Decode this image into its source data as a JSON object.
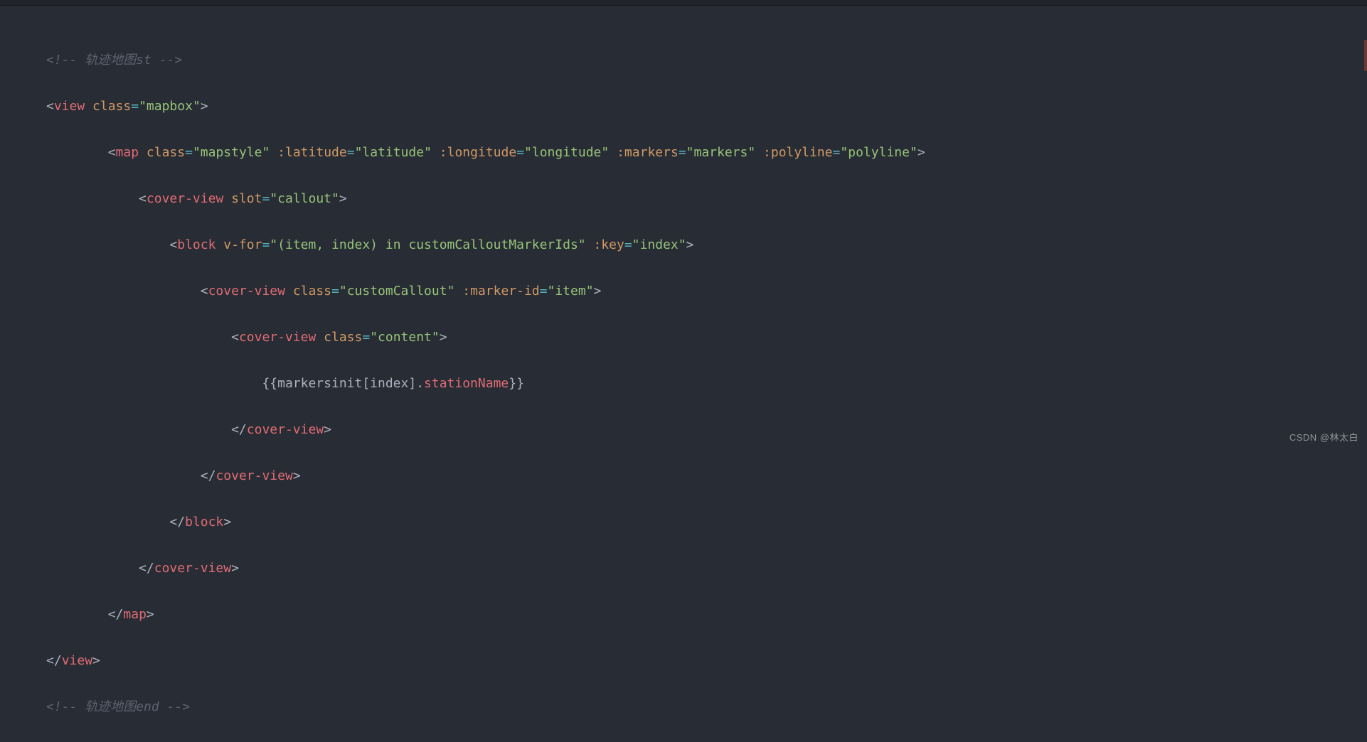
{
  "watermark": "CSDN @林太白",
  "tokens": {
    "commentStart": "<!-- 轨迹地图st -->",
    "commentEnd": "<!-- 轨迹地图end -->",
    "lt": "<",
    "ltSlash": "</",
    "gt": ">",
    "eq": "=",
    "q": "\"",
    "sp1": " ",
    "sp4": "    ",
    "indent0": "",
    "indent1": "    ",
    "indent2": "        ",
    "indent3": "            ",
    "indent4": "                ",
    "indent5": "                    ",
    "indent6": "                        ",
    "indent7": "                            ",
    "tag_view": "view",
    "tag_map": "map",
    "tag_coverview": "cover-view",
    "tag_block": "block",
    "attr_class": "class",
    "attr_slot": "slot",
    "attr_vfor": "v-for",
    "attr_key": ":key",
    "attr_lat": ":latitude",
    "attr_lon": ":longitude",
    "attr_markers": ":markers",
    "attr_polyline": ":polyline",
    "attr_markerid": ":marker-id",
    "val_mapbox": "mapbox",
    "val_mapstyle": "mapstyle",
    "val_latitude": "latitude",
    "val_longitude": "longitude",
    "val_markers": "markers",
    "val_polyline": "polyline",
    "val_callout": "callout",
    "val_vfor": "(item, index) in customCalloutMarkerIds",
    "val_index": "index",
    "val_customCallout": "customCallout",
    "val_item": "item",
    "val_content": "content",
    "interp_open": "{{",
    "interp_expr1": "markersinit[index].",
    "interp_prop": "stationName",
    "interp_close": "}}"
  }
}
